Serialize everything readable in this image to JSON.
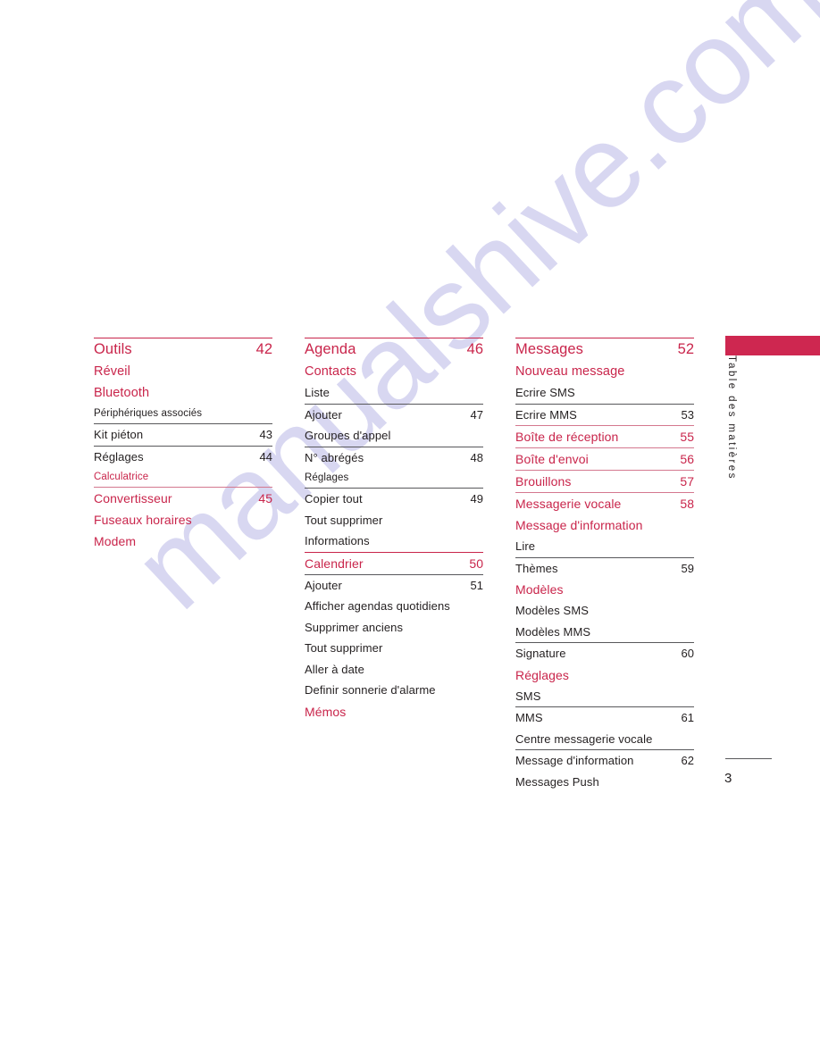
{
  "document": {
    "page_number": "3",
    "side_tab_label": "Table des matières",
    "watermark_text": "manualshive.com",
    "accent_color": "#c9254b",
    "tab_color": "#ce2750",
    "text_color": "#231f20"
  },
  "toc": {
    "columns": [
      {
        "id": "column-1",
        "rows": [
          {
            "label": "Outils",
            "page": "42",
            "level": "h1",
            "rule": "red"
          },
          {
            "label": "Réveil",
            "page": "",
            "level": "h2",
            "rule": "none"
          },
          {
            "label": "Bluetooth",
            "page": "",
            "level": "h2",
            "rule": "none"
          },
          {
            "label": "Périphériques associés",
            "page": "",
            "level": "sm",
            "rule": "none"
          },
          {
            "label": "Kit piéton",
            "page": "43",
            "level": "p",
            "rule": "dark"
          },
          {
            "label": "Réglages",
            "page": "44",
            "level": "p",
            "rule": "dark"
          },
          {
            "label": "Calculatrice",
            "page": "",
            "level": "smr",
            "rule": "none"
          },
          {
            "label": "Convertisseur",
            "page": "45",
            "level": "h3",
            "rule": "pink"
          },
          {
            "label": "Fuseaux horaires",
            "page": "",
            "level": "h3",
            "rule": "none"
          },
          {
            "label": "Modem",
            "page": "",
            "level": "h3",
            "rule": "none"
          }
        ]
      },
      {
        "id": "column-2",
        "rows": [
          {
            "label": "Agenda",
            "page": "46",
            "level": "h1",
            "rule": "red"
          },
          {
            "label": "Contacts",
            "page": "",
            "level": "h2",
            "rule": "none"
          },
          {
            "label": "Liste",
            "page": "",
            "level": "p",
            "rule": "none"
          },
          {
            "label": "Ajouter",
            "page": "47",
            "level": "p",
            "rule": "dark"
          },
          {
            "label": "Groupes d'appel",
            "page": "",
            "level": "p",
            "rule": "none"
          },
          {
            "label": "N° abrégés",
            "page": "48",
            "level": "p",
            "rule": "dark"
          },
          {
            "label": "Réglages",
            "page": "",
            "level": "sm",
            "rule": "none"
          },
          {
            "label": "Copier tout",
            "page": "49",
            "level": "p",
            "rule": "dark"
          },
          {
            "label": "Tout supprimer",
            "page": "",
            "level": "p",
            "rule": "none"
          },
          {
            "label": "Informations",
            "page": "",
            "level": "p",
            "rule": "none"
          },
          {
            "label": "Calendrier",
            "page": "50",
            "level": "h3",
            "rule": "red"
          },
          {
            "label": "Ajouter",
            "page": "51",
            "level": "p",
            "rule": "dark"
          },
          {
            "label": "Afficher agendas quotidiens",
            "page": "",
            "level": "p",
            "rule": "none"
          },
          {
            "label": "Supprimer anciens",
            "page": "",
            "level": "p",
            "rule": "none"
          },
          {
            "label": "Tout supprimer",
            "page": "",
            "level": "p",
            "rule": "none"
          },
          {
            "label": "Aller à date",
            "page": "",
            "level": "p",
            "rule": "none"
          },
          {
            "label": "Definir sonnerie d'alarme",
            "page": "",
            "level": "p",
            "rule": "none"
          },
          {
            "label": "Mémos",
            "page": "",
            "level": "h3",
            "rule": "none"
          }
        ]
      },
      {
        "id": "column-3",
        "rows": [
          {
            "label": "Messages",
            "page": "52",
            "level": "h1",
            "rule": "red"
          },
          {
            "label": "Nouveau message",
            "page": "",
            "level": "h2",
            "rule": "none"
          },
          {
            "label": "Ecrire SMS",
            "page": "",
            "level": "p",
            "rule": "none"
          },
          {
            "label": "Ecrire MMS",
            "page": "53",
            "level": "p",
            "rule": "dark"
          },
          {
            "label": "Boîte de réception",
            "page": "55",
            "level": "h3",
            "rule": "pink"
          },
          {
            "label": "Boîte d'envoi",
            "page": "56",
            "level": "h3",
            "rule": "pink"
          },
          {
            "label": "Brouillons",
            "page": "57",
            "level": "h3",
            "rule": "pink"
          },
          {
            "label": "Messagerie vocale",
            "page": "58",
            "level": "h3",
            "rule": "pink"
          },
          {
            "label": "Message d'information",
            "page": "",
            "level": "h3",
            "rule": "none"
          },
          {
            "label": "Lire",
            "page": "",
            "level": "p",
            "rule": "none"
          },
          {
            "label": "Thèmes",
            "page": "59",
            "level": "p",
            "rule": "dark"
          },
          {
            "label": "Modèles",
            "page": "",
            "level": "h3",
            "rule": "none"
          },
          {
            "label": "Modèles SMS",
            "page": "",
            "level": "p",
            "rule": "none"
          },
          {
            "label": "Modèles MMS",
            "page": "",
            "level": "p",
            "rule": "none"
          },
          {
            "label": "Signature",
            "page": "60",
            "level": "p",
            "rule": "dark"
          },
          {
            "label": "Réglages",
            "page": "",
            "level": "h3",
            "rule": "none"
          },
          {
            "label": "SMS",
            "page": "",
            "level": "p",
            "rule": "none"
          },
          {
            "label": "MMS",
            "page": "61",
            "level": "p",
            "rule": "dark"
          },
          {
            "label": "Centre messagerie vocale",
            "page": "",
            "level": "p",
            "rule": "none"
          },
          {
            "label": "Message d'information",
            "page": "62",
            "level": "p",
            "rule": "dark"
          },
          {
            "label": "Messages Push",
            "page": "",
            "level": "p",
            "rule": "none"
          }
        ]
      }
    ]
  }
}
